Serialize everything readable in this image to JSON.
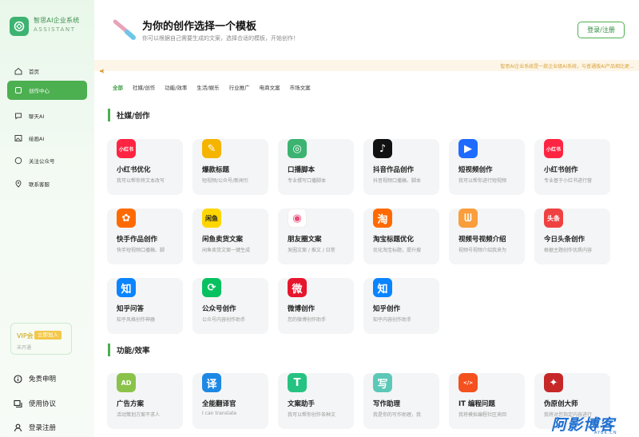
{
  "app": {
    "name": "智思AI企业系统",
    "sub": "ASSISTANT"
  },
  "nav": [
    {
      "label": "首页",
      "icon": "home-icon"
    },
    {
      "label": "创作中心",
      "icon": "create-icon"
    },
    {
      "label": "聊天AI",
      "icon": "chat-icon"
    },
    {
      "label": "绘画AI",
      "icon": "image-icon"
    },
    {
      "label": "关注公众号",
      "icon": "follow-icon"
    },
    {
      "label": "联系客服",
      "icon": "location-icon"
    }
  ],
  "vip": {
    "title": "VIP会",
    "button": "立即加入",
    "status": "未开通"
  },
  "bottom_links": [
    {
      "label": "免责申明",
      "icon": "info-icon"
    },
    {
      "label": "使用协议",
      "icon": "agreement-icon"
    },
    {
      "label": "登录注册",
      "icon": "user-icon"
    }
  ],
  "header": {
    "title": "为你的创作选择一个模板",
    "subtitle": "你可以根据自己需要生成的文案，选择合适的模板，开始创作！",
    "login": "登录/注册"
  },
  "notice": "智思AI企业系统是一款企业级AI系统，与普通版AI产品相比更…",
  "filters": [
    "全部",
    "社媒/创作",
    "功能/效率",
    "生活/娱乐",
    "行业推广",
    "电商文案",
    "市场文案"
  ],
  "sections": [
    {
      "title": "社媒/创作",
      "cards": [
        {
          "name": "小红书优化",
          "desc": "我可以帮你将文本改写",
          "icon": "xiaohongshu-icon",
          "color": "#ff2442",
          "glyph": "小红书"
        },
        {
          "name": "爆款标题",
          "desc": "短视频/公众号/新闻引",
          "icon": "pen-icon",
          "color": "#f5b400",
          "glyph": "✎"
        },
        {
          "name": "口播脚本",
          "desc": "专业撰写口播脚本",
          "icon": "script-icon",
          "color": "#3cb371",
          "glyph": "◎"
        },
        {
          "name": "抖音作品创作",
          "desc": "抖音视频口播稿、脚本",
          "icon": "douyin-icon",
          "color": "#111111",
          "glyph": "♪"
        },
        {
          "name": "短视频创作",
          "desc": "我可以帮你进行短视频",
          "icon": "video-play-icon",
          "color": "#1f6bff",
          "glyph": "▶"
        },
        {
          "name": "小红书创作",
          "desc": "专业基于小红书进行营",
          "icon": "xiaohongshu-icon",
          "color": "#ff2442",
          "glyph": "小红书"
        },
        {
          "name": "快手作品创作",
          "desc": "快手短视频口播稿、脚",
          "icon": "kuaishou-icon",
          "color": "#ff6a00",
          "glyph": "✿"
        },
        {
          "name": "闲鱼卖货文案",
          "desc": "闲鱼卖货文案一键生成",
          "icon": "xianyu-icon",
          "color": "#ffd600",
          "glyph": "闲鱼"
        },
        {
          "name": "朋友圈文案",
          "desc": "发圈文案 / 推文 / 日常",
          "icon": "moments-icon",
          "color": "#ffffff",
          "glyph": "◉"
        },
        {
          "name": "淘宝标题优化",
          "desc": "优化淘宝标题，提升搜",
          "icon": "taobao-icon",
          "color": "#ff6a00",
          "glyph": "淘"
        },
        {
          "name": "视频号视频介绍",
          "desc": "视频号视频介绍我来为",
          "icon": "channels-icon",
          "color": "#fa9d3b",
          "glyph": "ᗯ"
        },
        {
          "name": "今日头条创作",
          "desc": "根据主题创作优质内容",
          "icon": "toutiao-icon",
          "color": "#f04142",
          "glyph": "头条"
        },
        {
          "name": "知乎问答",
          "desc": "知乎风格创作神器",
          "icon": "zhihu-icon",
          "color": "#0a84ff",
          "glyph": "知"
        },
        {
          "name": "公众号创作",
          "desc": "公众号内容创作助手",
          "icon": "wechat-official-icon",
          "color": "#07c160",
          "glyph": "⟳"
        },
        {
          "name": "微博创作",
          "desc": "您的微博创作助手",
          "icon": "weibo-icon",
          "color": "#e6162d",
          "glyph": "微"
        },
        {
          "name": "知乎创作",
          "desc": "知乎内容创作助手",
          "icon": "zhihu-icon",
          "color": "#0a84ff",
          "glyph": "知"
        }
      ]
    },
    {
      "title": "功能/效率",
      "cards": [
        {
          "name": "广告方案",
          "desc": "活动策划方案不求人",
          "icon": "ad-icon",
          "color": "#8bc34a",
          "glyph": "AD"
        },
        {
          "name": "全能翻译官",
          "desc": "I can translate",
          "icon": "translate-icon",
          "color": "#1e88e5",
          "glyph": "译"
        },
        {
          "name": "文案助手",
          "desc": "我可以帮你创作各种文",
          "icon": "text-icon",
          "color": "#26c281",
          "glyph": "T"
        },
        {
          "name": "写作助理",
          "desc": "我是你的写作助理，我",
          "icon": "write-icon",
          "color": "#5cc8b8",
          "glyph": "写"
        },
        {
          "name": "IT 编程问题",
          "desc": "我将模拟编程社区来回",
          "icon": "code-icon",
          "color": "#f4511e",
          "glyph": "</>"
        },
        {
          "name": "伪原创大师",
          "desc": "我将对您指定内容进行",
          "icon": "fire-icon",
          "color": "#c62828",
          "glyph": "✦"
        }
      ]
    }
  ],
  "watermark": {
    "text": "阿影博客",
    "sub": "AYBK.CN"
  }
}
